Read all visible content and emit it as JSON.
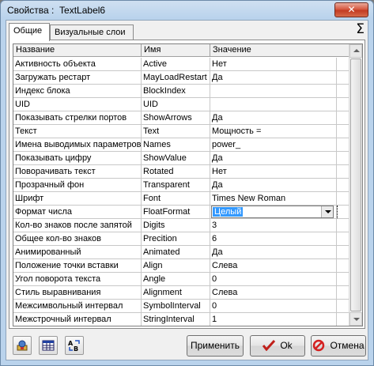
{
  "window": {
    "title_prefix": "Свойства :",
    "title_object": "TextLabel6",
    "close_glyph": "✕"
  },
  "tabs": [
    {
      "label": "Общие",
      "active": true
    },
    {
      "label": "Визуальные слои",
      "active": false
    }
  ],
  "sigma_glyph": "Σ",
  "grid": {
    "headers": [
      "Название",
      "Имя",
      "Значение"
    ],
    "rows": [
      {
        "title": "Активность объекта",
        "name": "Active",
        "value": "Нет"
      },
      {
        "title": "Загружать рестарт",
        "name": "MayLoadRestart",
        "value": "Да"
      },
      {
        "title": "Индекс блока",
        "name": "BlockIndex",
        "value": ""
      },
      {
        "title": "UID",
        "name": "UID",
        "value": ""
      },
      {
        "title": "Показывать стрелки портов",
        "name": "ShowArrows",
        "value": "Да"
      },
      {
        "title": "Текст",
        "name": "Text",
        "value": "Мощность ="
      },
      {
        "title": "Имена выводимых параметров",
        "name": "Names",
        "value": "power_"
      },
      {
        "title": "Показывать цифру",
        "name": "ShowValue",
        "value": "Да"
      },
      {
        "title": "Поворачивать текст",
        "name": "Rotated",
        "value": "Нет"
      },
      {
        "title": "Прозрачный фон",
        "name": "Transparent",
        "value": "Да"
      },
      {
        "title": "Шрифт",
        "name": "Font",
        "value": "Times New Roman"
      },
      {
        "title": "Формат числа",
        "name": "FloatFormat",
        "value": "Целый",
        "editing": true
      },
      {
        "title": "Кол-во знаков после запятой",
        "name": "Digits",
        "value": "3"
      },
      {
        "title": "Общее кол-во знаков",
        "name": "Precition",
        "value": "6"
      },
      {
        "title": "Анимированный",
        "name": "Animated",
        "value": "Да"
      },
      {
        "title": "Положение точки вставки",
        "name": "Align",
        "value": "Слева"
      },
      {
        "title": "Угол поворота текста",
        "name": "Angle",
        "value": "0"
      },
      {
        "title": "Стиль выравнивания",
        "name": "Alignment",
        "value": "Слева"
      },
      {
        "title": "Межсимвольный интервал",
        "name": "SymbolInterval",
        "value": "0"
      },
      {
        "title": "Межстрочный интервал",
        "name": "StringInterval",
        "value": "1"
      }
    ]
  },
  "buttons": {
    "apply": "Применить",
    "ok": "Ok",
    "cancel": "Отмена"
  },
  "colors": {
    "selection": "#3399ff",
    "ok_check": "#c0201a",
    "cancel_icon": "#d42020"
  }
}
